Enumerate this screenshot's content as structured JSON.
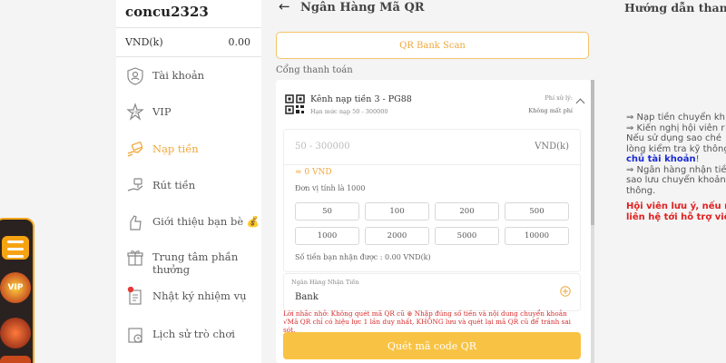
{
  "user": {
    "username": "concu2323"
  },
  "balance": {
    "label": "VND(k)",
    "value": "0.00"
  },
  "sidebar": {
    "items": [
      {
        "label": "Tài khoản"
      },
      {
        "label": "VIP"
      },
      {
        "label": "Nạp tiền"
      },
      {
        "label": "Rút tiền"
      },
      {
        "label": "Giới thiệu bạn bè 💰"
      },
      {
        "label": "Trung tâm phần thưởng"
      },
      {
        "label": "Nhật ký nhiệm vụ"
      },
      {
        "label": "Lịch sử trò chơi"
      }
    ]
  },
  "header": {
    "title": "Ngân Hàng Mã QR"
  },
  "qr_scan_button": "QR Bank Scan",
  "gateway_label": "Cổng thanh toán",
  "channel": {
    "name": "Kênh nạp tiền 3 - PG88",
    "limit": "Hạn mức nạp 50 - 300000",
    "fee_label": "Phí xử lý:",
    "fee_value": "Không mất phí"
  },
  "amount": {
    "placeholder": "50 - 300000",
    "unit": "VND(k)",
    "converted": "≈ 0 VND",
    "unit_note": "Đơn vị tính là 1000",
    "quick": [
      "50",
      "100",
      "200",
      "500",
      "1000",
      "2000",
      "5000",
      "10000"
    ],
    "received": "Số tiền bạn nhận được : 0.00 VND(k)"
  },
  "bank": {
    "label": "Ngân Hàng Nhận Tiền",
    "value": "Bank"
  },
  "warning": "Lời nhắc nhở: Không quét mã QR cũ ⊛ Nhập đúng số tiền và nội dung chuyển khoản √Mã QR chỉ có hiệu lực 1 lần duy nhất, KHÔNG lưu và quét lại mã QR cũ để tránh sai sót.",
  "scan_button": "Quét mã code QR",
  "guide": {
    "title": "Hướng dẫn thanh t",
    "lines": [
      "⇒ Nạp tiền chuyển kh",
      "⇒ Kiến nghị hội viên r",
      "Nếu sử dụng sao ché",
      "lòng kiểm tra kỹ thông"
    ],
    "link": "chủ tài khoản",
    "link_suffix": "!",
    "lines2": [
      "⇒ Ngân hàng nhận tiề",
      "sao lưu chuyển khoản",
      "thông."
    ],
    "warn1": "Hội viên lưu ý, nếu r",
    "warn2": "liên hệ tới hỗ trợ viê"
  },
  "colors": {
    "accent": "#f0a73a",
    "button": "#f8c344",
    "warning": "#d62c2c",
    "link": "#1a2ad1"
  }
}
